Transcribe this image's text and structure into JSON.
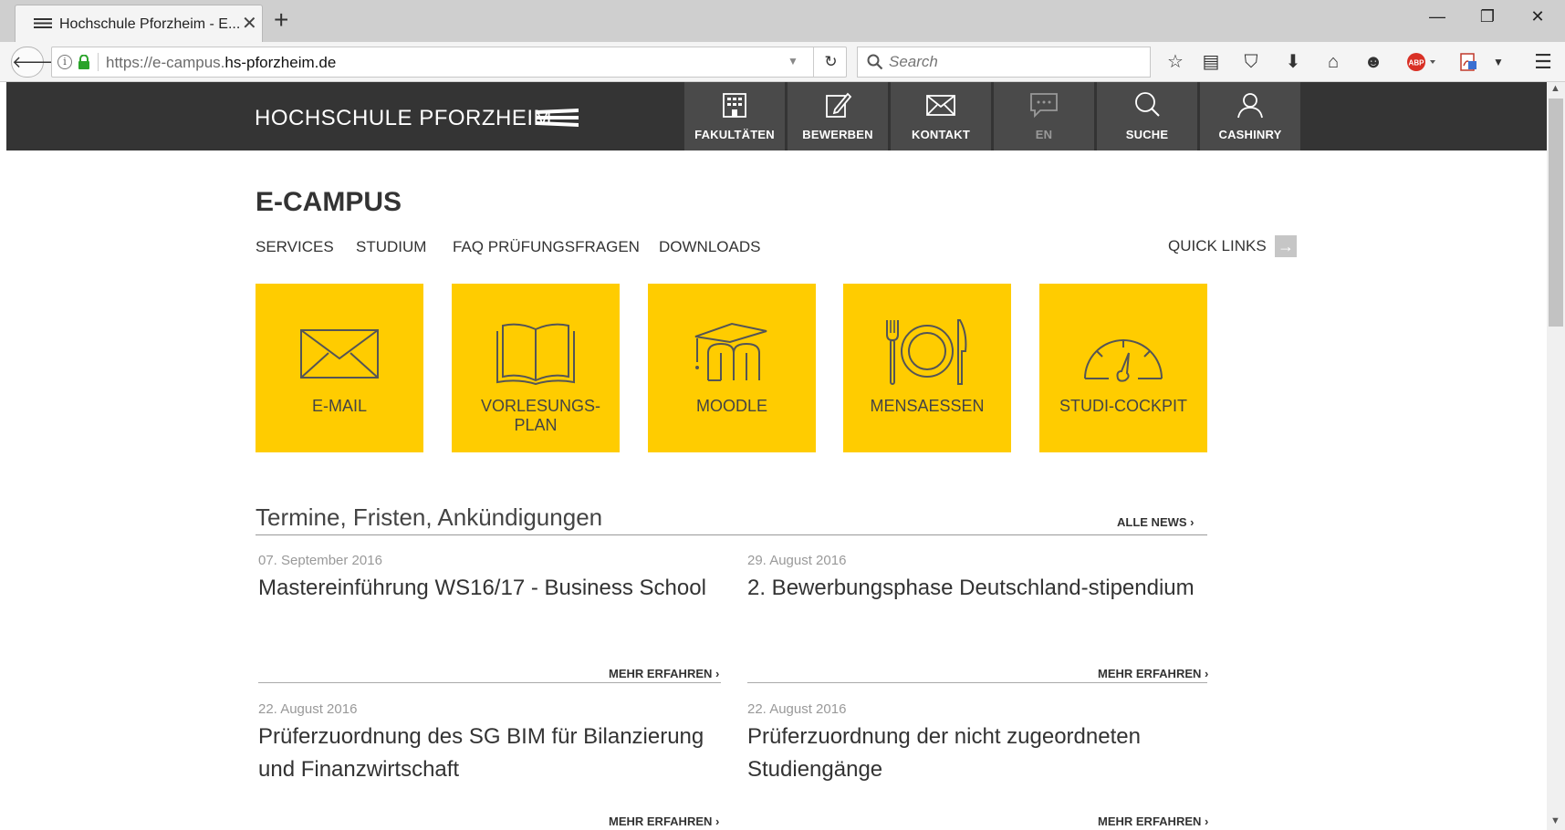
{
  "browser": {
    "tab_title": "Hochschule Pforzheim - E...",
    "tab_close": "✕",
    "new_tab": "+",
    "url_prefix": "https://e-campus.",
    "url_host": "hs-pforzheim.de",
    "search_placeholder": "Search",
    "window_minimize": "—",
    "window_restore": "❐",
    "window_close": "✕"
  },
  "header": {
    "logo_text": "HOCHSCHULE PFORZHEIM",
    "nav": [
      {
        "label": "FAKULTÄTEN",
        "icon": "building-icon"
      },
      {
        "label": "BEWERBEN",
        "icon": "edit-icon"
      },
      {
        "label": "KONTAKT",
        "icon": "mail-icon"
      },
      {
        "label": "EN",
        "icon": "chat-icon"
      },
      {
        "label": "SUCHE",
        "icon": "search-icon"
      },
      {
        "label": "CASHINRY",
        "icon": "user-icon"
      }
    ]
  },
  "content": {
    "title": "E-CAMPUS",
    "subnav": [
      "SERVICES",
      "STUDIUM",
      "FAQ PRÜFUNGSFRAGEN",
      "DOWNLOADS"
    ],
    "quick_links": "QUICK LINKS",
    "tiles": [
      {
        "label": "E-MAIL",
        "icon": "envelope-icon"
      },
      {
        "label": "VORLESUNGS-PLAN",
        "icon": "book-icon"
      },
      {
        "label": "MOODLE",
        "icon": "moodle-icon"
      },
      {
        "label": "MENSAESSEN",
        "icon": "plate-cutlery-icon"
      },
      {
        "label": "STUDI-COCKPIT",
        "icon": "speedometer-icon"
      }
    ],
    "news_heading": "Termine, Fristen, Ankündigungen",
    "all_news": "ALLE NEWS ›",
    "news": [
      {
        "date": "07. September 2016",
        "title": "Mastereinführung WS16/17 - Business School",
        "more": "MEHR ERFAHREN ›"
      },
      {
        "date": "29. August 2016",
        "title": "2. Bewerbungsphase Deutschland-stipendium",
        "more": "MEHR ERFAHREN ›"
      },
      {
        "date": "22. August 2016",
        "title": "Prüferzuordnung des SG BIM für Bilanzierung und Finanzwirtschaft",
        "more": "MEHR ERFAHREN ›"
      },
      {
        "date": "22. August 2016",
        "title": "Prüferzuordnung der nicht zugeordneten Studiengänge",
        "more": "MEHR ERFAHREN ›"
      }
    ]
  },
  "colors": {
    "accent_yellow": "#ffcc00",
    "header_dark": "#343434",
    "header_nav": "#4a4a4a"
  }
}
